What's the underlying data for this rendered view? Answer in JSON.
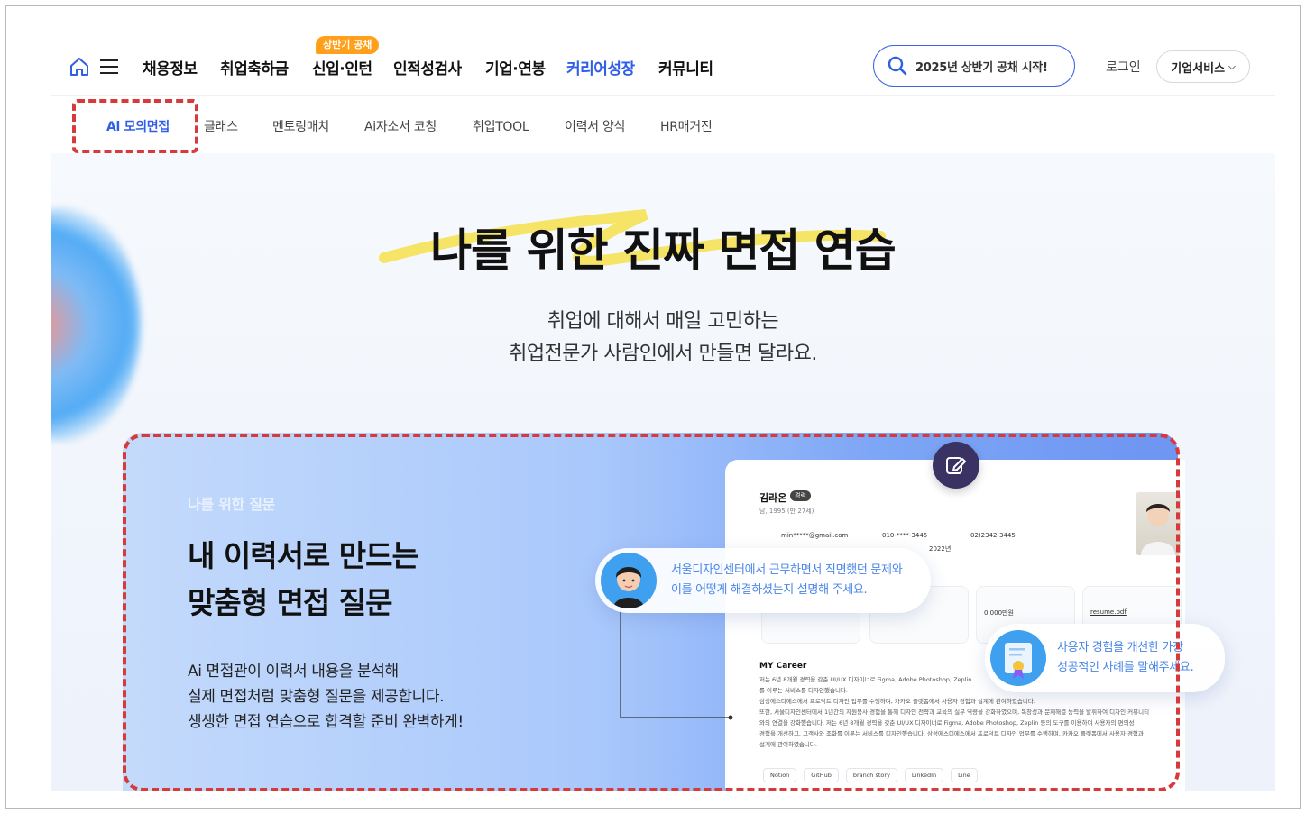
{
  "gnb": {
    "menu": [
      "채용정보",
      "취업축하금",
      "신입·인턴",
      "인적성검사",
      "기업·연봉",
      "커리어성장",
      "커뮤니티"
    ],
    "active_index": 5,
    "badge": "상반기 공채",
    "search_text": "2025년 상반기 공채 시작!",
    "login": "로그인",
    "business": "기업서비스"
  },
  "subnav": {
    "items": [
      "Ai 모의면접",
      "클래스",
      "멘토링매치",
      "Ai자소서 코칭",
      "취업TOOL",
      "이력서 양식",
      "HR매거진"
    ],
    "active_index": 0
  },
  "hero": {
    "title": "나를 위한 진짜 면접 연습",
    "subtitle_line1": "취업에 대해서 매일 고민하는",
    "subtitle_line2": "취업전문가 사람인에서 만들면 달라요."
  },
  "card": {
    "eyebrow": "나를 위한 질문",
    "heading_line1": "내 이력서로 만드는",
    "heading_line2": "맞춤형 면접 질문",
    "desc_line1": "Ai 면접관이 이력서 내용을 분석해",
    "desc_line2": "실제 면접처럼 맞춤형 질문을 제공합니다.",
    "desc_line3": "생생한 면접 연습으로 합격할 준비 완벽하게!"
  },
  "resume": {
    "name": "김라온",
    "tag": "경력",
    "birth": "남, 1995 (만 27세)",
    "email": "min*****@gmail.com",
    "phone": "010-****-3445",
    "tel": "02)2342-3445",
    "year": "2022년",
    "salary": "0,000만원",
    "file": "resume.pdf",
    "career_title": "MY Career",
    "para1": "저는 6년 8개월 경력을 갖춘 UI/UX 디자이너로 Figma, Adobe Photoshop, Zeplin",
    "para2": "를 이루는 서비스를 디자인했습니다.",
    "para3": "삼성에스디에스에서 프로덕트 디자인 업무를 수행하며, 카카오 플랫폼에서 사용자 경험과 설계에 관여하였습니다.",
    "para4": "또한, 서울디자인센터에서 1년간의 자원봉사 경험을 통해 디자인 전략과 교육의 실무 역량을 강화하였으며, 독창성과 문제해결 능력을 발휘하여 디자인 커뮤니티",
    "para5": "와의 연결을 강화했습니다. 저는 6년 8개월 경력을 갖춘 UI/UX 디자이너로 Figma, Adobe Photoshop, Zeplin 등의 도구를 이용하여 사용자의 편의성",
    "para6": "경험을 개선하고, 고객사와 조화를 이루는 서비스를 디자인했습니다. 삼성에스디에스에서 프로덕트 디자인 업무를 수행하며, 카카오 플랫폼에서 사용자 경험과",
    "para7": "설계에 관여하였습니다.",
    "links": [
      "Notion",
      "GitHub",
      "branch story",
      "LinkedIn",
      "Line"
    ]
  },
  "bubbles": {
    "q1_line1": "서울디자인센터에서 근무하면서 직면했던 문제와",
    "q1_line2": "이를 어떻게 해결하셨는지 설명해 주세요.",
    "q2_line1": "사용자 경험을 개선한 가장",
    "q2_line2": "성공적인 사례를 말해주세요."
  },
  "colors": {
    "accent": "#2f5ee8",
    "badge": "#ff9f1a",
    "highlight_box": "#d63a3a",
    "bubble_text": "#4a86e8"
  }
}
